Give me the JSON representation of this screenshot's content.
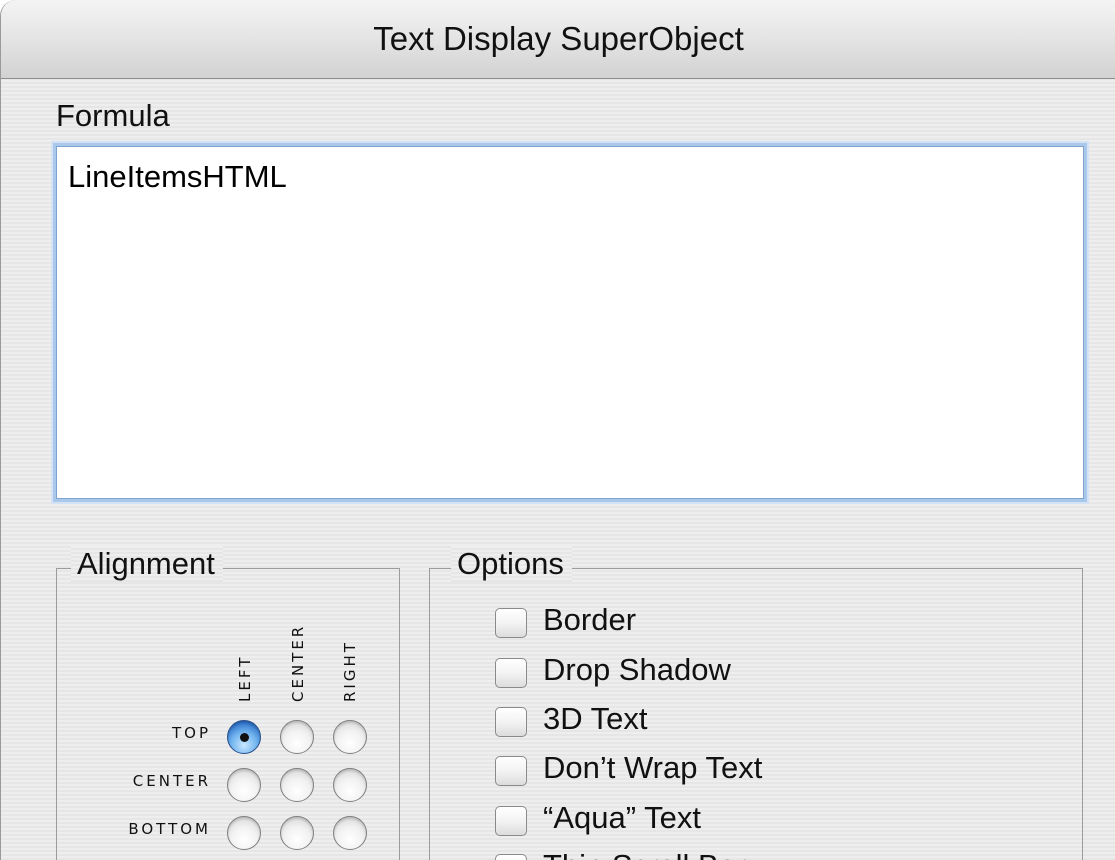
{
  "window": {
    "title": "Text Display SuperObject"
  },
  "formula": {
    "label": "Formula",
    "value": "LineItemsHTML"
  },
  "alignment": {
    "label": "Alignment",
    "columns": [
      "LEFT",
      "CENTER",
      "RIGHT"
    ],
    "rows": [
      "TOP",
      "CENTER",
      "BOTTOM"
    ],
    "selected": "TOP-LEFT"
  },
  "options": {
    "label": "Options",
    "items": [
      {
        "label": "Border",
        "checked": false
      },
      {
        "label": "Drop Shadow",
        "checked": false
      },
      {
        "label": "3D Text",
        "checked": false
      },
      {
        "label": "Don’t Wrap Text",
        "checked": false
      },
      {
        "label": "“Aqua” Text",
        "checked": false
      },
      {
        "label": "Thin Scroll Bar",
        "checked": false
      }
    ]
  },
  "colors": {
    "accent": "#2d6fc9",
    "focus_ring": "#a9c8ea"
  }
}
